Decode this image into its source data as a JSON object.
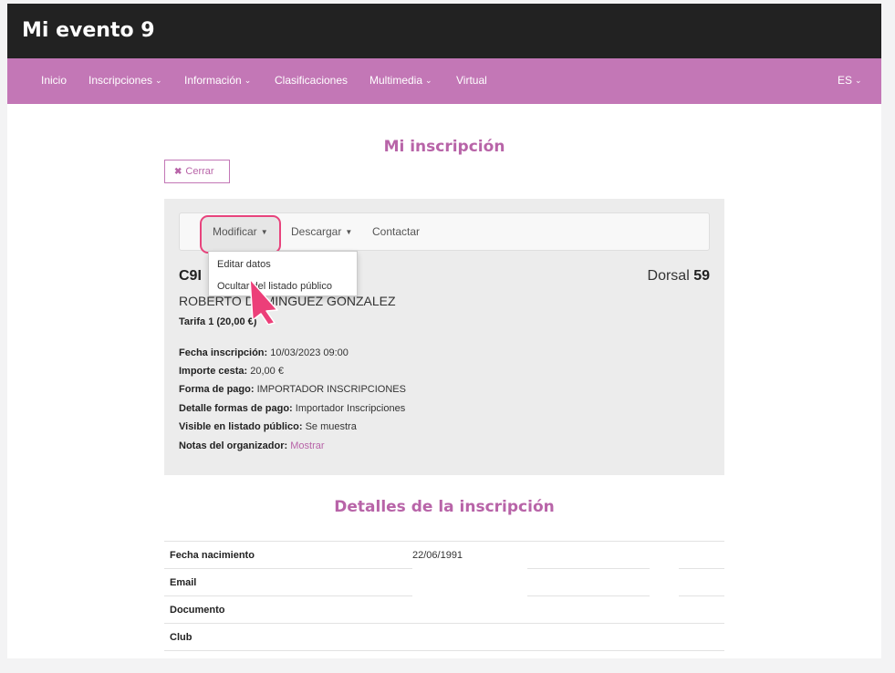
{
  "header": {
    "title": "Mi evento 9"
  },
  "nav": {
    "items": [
      {
        "label": "Inicio",
        "chevron": false
      },
      {
        "label": "Inscripciones",
        "chevron": true
      },
      {
        "label": "Información",
        "chevron": true
      },
      {
        "label": "Clasificaciones",
        "chevron": false
      },
      {
        "label": "Multimedia",
        "chevron": true
      },
      {
        "label": "Virtual",
        "chevron": false
      }
    ],
    "language": "ES"
  },
  "main": {
    "heading": "Mi inscripción",
    "close_label": "Cerrar",
    "tabs": {
      "modify": "Modificar",
      "download": "Descargar",
      "contact": "Contactar"
    },
    "dropdown": {
      "edit": "Editar datos",
      "hide": "Ocultar del listado público"
    },
    "registration": {
      "code": "C9I",
      "dorsal_label": "Dorsal",
      "dorsal_number": "59",
      "name": "ROBERTO DOMINGUEZ GONZALEZ",
      "tariff": "Tarifa 1 (20,00 €)"
    },
    "info": [
      {
        "label": "Fecha inscripción:",
        "value": "10/03/2023 09:00"
      },
      {
        "label": "Importe cesta:",
        "value": "20,00 €"
      },
      {
        "label": "Forma de pago:",
        "value": "IMPORTADOR INSCRIPCIONES"
      },
      {
        "label": "Detalle formas de pago:",
        "value": "Importador Inscripciones"
      },
      {
        "label": "Visible en listado público:",
        "value": "Se muestra"
      },
      {
        "label": "Notas del organizador:",
        "value": "Mostrar"
      }
    ]
  },
  "details": {
    "heading": "Detalles de la inscripción",
    "rows": [
      {
        "label": "Fecha nacimiento",
        "value": "22/06/1991"
      },
      {
        "label": "Email",
        "value": ""
      },
      {
        "label": "Documento",
        "value": ""
      },
      {
        "label": "Club",
        "value": ""
      }
    ]
  },
  "colors": {
    "accent": "#c377b6",
    "heading": "#b864a8",
    "highlight": "#e8447d",
    "topbar": "#222222"
  }
}
